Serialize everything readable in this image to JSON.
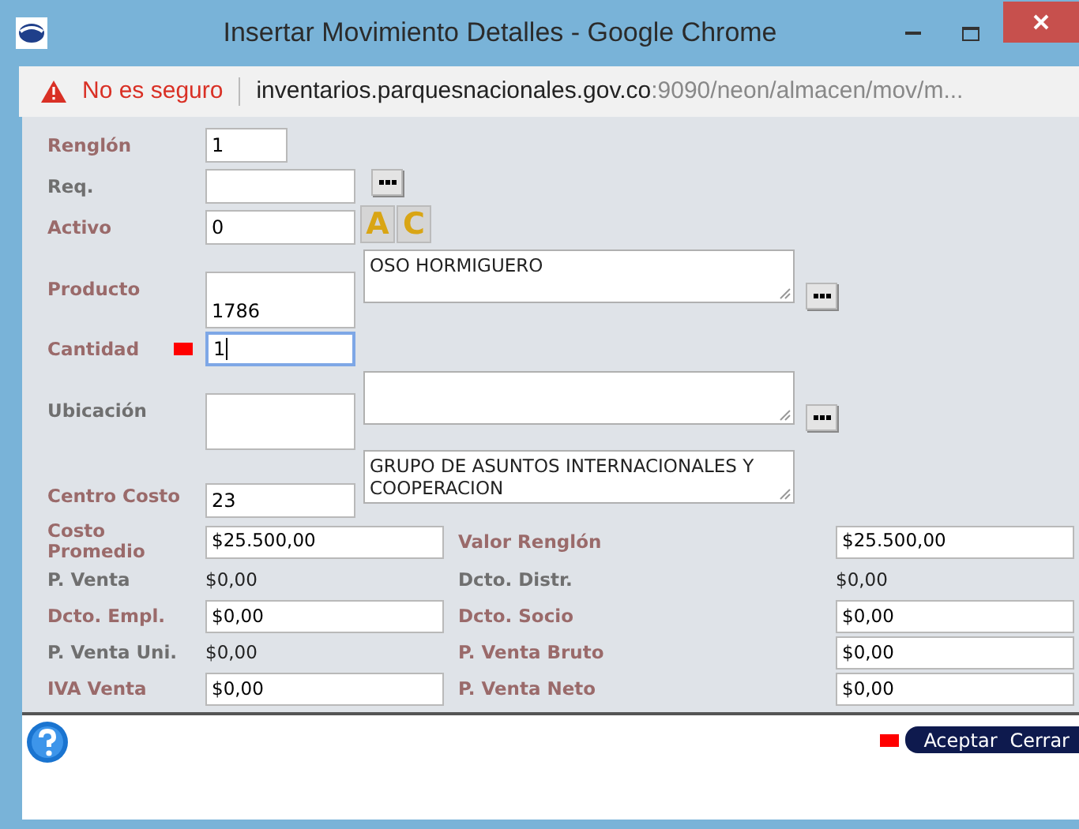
{
  "window": {
    "title": "Insertar Movimiento Detalles - Google Chrome"
  },
  "address_bar": {
    "security": "No es seguro",
    "host": "inventarios.parquesnacionales.gov.co",
    "path": ":9090/neon/almacen/mov/m..."
  },
  "top_fields": [
    {
      "kind": "short",
      "label": "Renglón",
      "required": true,
      "value": "1"
    },
    {
      "kind": "input",
      "label": "Req.",
      "required": false,
      "lookup": true
    },
    {
      "kind": "input",
      "label": "Activo",
      "required": true,
      "value": "0",
      "letter_buttons": [
        "A",
        "C"
      ]
    },
    {
      "kind": "tall",
      "label": "Producto",
      "required": true,
      "value": "1786",
      "description": "OSO HORMIGUERO",
      "lookup": true
    },
    {
      "kind": "input",
      "label": "Cantidad",
      "required": true,
      "marker": true,
      "focused": true,
      "value": "1"
    },
    {
      "kind": "tall",
      "label": "Ubicación",
      "required": false,
      "lookup": true
    },
    {
      "kind": "low",
      "label": "Centro Costo",
      "required": true,
      "value": "23",
      "description": "GRUPO DE ASUNTOS INTERNACIONALES Y COOPERACION"
    }
  ],
  "bottom_rows": [
    [
      {
        "label": "Costo Promedio",
        "required": true,
        "kind": "field",
        "value": "$25.500,00"
      },
      {
        "label": "Valor Renglón",
        "required": true,
        "kind": "field",
        "value": "$25.500,00"
      }
    ],
    [
      {
        "label": "P. Venta",
        "required": false,
        "kind": "text",
        "value": "$0,00"
      },
      {
        "label": "Dcto. Distr.",
        "required": false,
        "kind": "text",
        "value": "$0,00"
      }
    ],
    [
      {
        "label": "Dcto. Empl.",
        "required": true,
        "kind": "field",
        "value": "$0,00"
      },
      {
        "label": "Dcto. Socio",
        "required": true,
        "kind": "field",
        "value": "$0,00"
      }
    ],
    [
      {
        "label": "P. Venta Uni.",
        "required": false,
        "kind": "text",
        "value": "$0,00"
      },
      {
        "label": "P. Venta Bruto",
        "required": true,
        "kind": "field",
        "value": "$0,00"
      }
    ],
    [
      {
        "label": "IVA Venta",
        "required": true,
        "kind": "field",
        "value": "$0,00"
      },
      {
        "label": "P. Venta Neto",
        "required": true,
        "kind": "field",
        "value": "$0,00"
      }
    ]
  ],
  "footer": {
    "marker": true,
    "buttons": [
      "Aceptar",
      "Cerrar"
    ]
  }
}
